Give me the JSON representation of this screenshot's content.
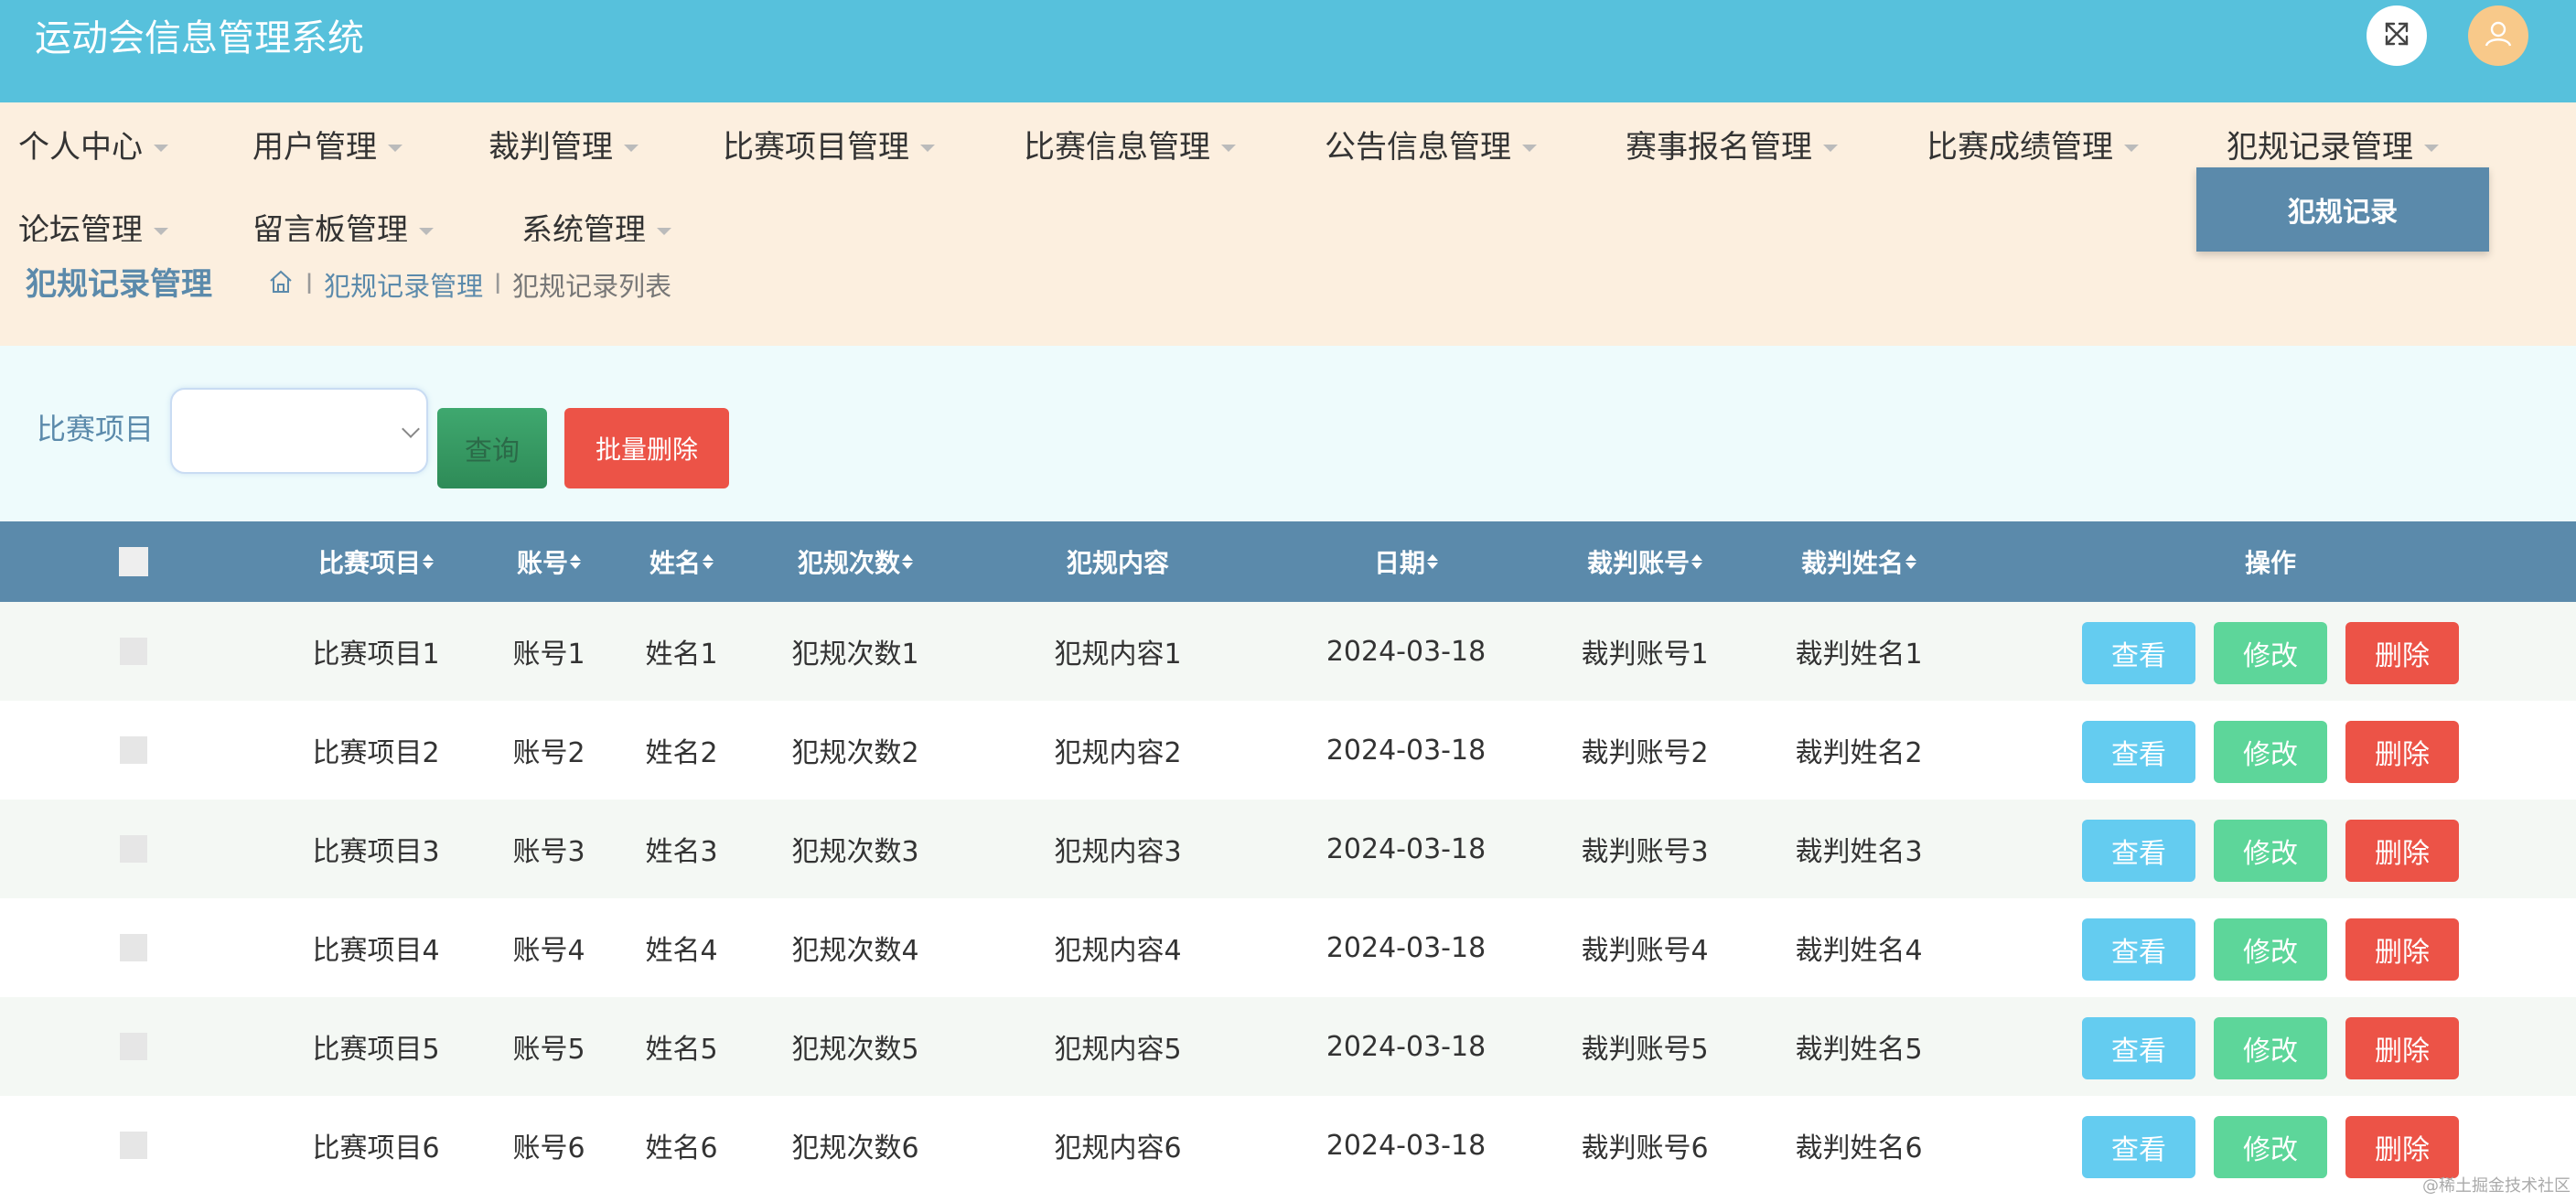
{
  "app": {
    "title": "运动会信息管理系统"
  },
  "nav": {
    "items": [
      {
        "label": "个人中心"
      },
      {
        "label": "用户管理"
      },
      {
        "label": "裁判管理"
      },
      {
        "label": "比赛项目管理"
      },
      {
        "label": "比赛信息管理"
      },
      {
        "label": "公告信息管理"
      },
      {
        "label": "赛事报名管理"
      },
      {
        "label": "比赛成绩管理"
      },
      {
        "label": "犯规记录管理"
      },
      {
        "label": "论坛管理"
      },
      {
        "label": "留言板管理"
      },
      {
        "label": "系统管理"
      }
    ],
    "open_dropdown_item": "犯规记录"
  },
  "breadcrumb": {
    "page_title": "犯规记录管理",
    "items": [
      "犯规记录管理",
      "犯规记录列表"
    ],
    "separator": "l"
  },
  "search": {
    "label": "比赛项目",
    "select_value": "",
    "query_label": "查询",
    "batch_delete_label": "批量删除"
  },
  "table": {
    "columns": [
      "比赛项目",
      "账号",
      "姓名",
      "犯规次数",
      "犯规内容",
      "日期",
      "裁判账号",
      "裁判姓名",
      "操作"
    ],
    "sortable": [
      true,
      true,
      true,
      true,
      false,
      true,
      true,
      true,
      false
    ],
    "rows": [
      [
        "比赛项目1",
        "账号1",
        "姓名1",
        "犯规次数1",
        "犯规内容1",
        "2024-03-18",
        "裁判账号1",
        "裁判姓名1"
      ],
      [
        "比赛项目2",
        "账号2",
        "姓名2",
        "犯规次数2",
        "犯规内容2",
        "2024-03-18",
        "裁判账号2",
        "裁判姓名2"
      ],
      [
        "比赛项目3",
        "账号3",
        "姓名3",
        "犯规次数3",
        "犯规内容3",
        "2024-03-18",
        "裁判账号3",
        "裁判姓名3"
      ],
      [
        "比赛项目4",
        "账号4",
        "姓名4",
        "犯规次数4",
        "犯规内容4",
        "2024-03-18",
        "裁判账号4",
        "裁判姓名4"
      ],
      [
        "比赛项目5",
        "账号5",
        "姓名5",
        "犯规次数5",
        "犯规内容5",
        "2024-03-18",
        "裁判账号5",
        "裁判姓名5"
      ],
      [
        "比赛项目6",
        "账号6",
        "姓名6",
        "犯规次数6",
        "犯规内容6",
        "2024-03-18",
        "裁判账号6",
        "裁判姓名6"
      ]
    ],
    "actions": {
      "view": "查看",
      "edit": "修改",
      "delete": "删除"
    }
  },
  "watermark": "@稀土掘金技术社区",
  "icons": {
    "fullscreen": "expand-arrows-icon",
    "user": "user-avatar-icon",
    "home": "home-icon"
  },
  "colors": {
    "topbar": "#57c1dc",
    "nav_bg": "#fcefdf",
    "accent": "#5b8aab",
    "view_btn": "#64ccf0",
    "edit_btn": "#5dd69a",
    "delete_btn": "#ec5347"
  }
}
